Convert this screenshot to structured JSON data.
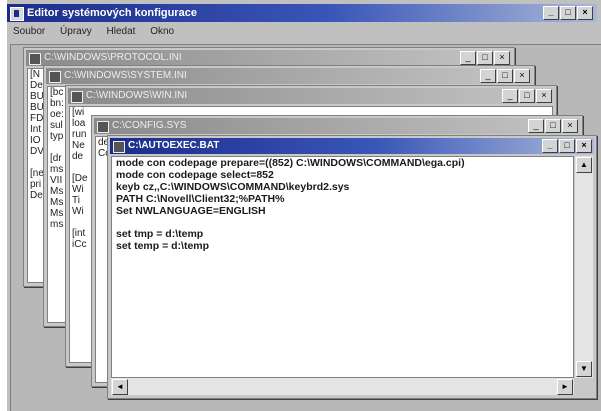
{
  "app": {
    "title": "Editor systémových konfigurace"
  },
  "menu": [
    "Soubor",
    "Úpravy",
    "Hledat",
    "Okno"
  ],
  "caption_buttons": {
    "minimize": "_",
    "maximize": "□",
    "close": "×"
  },
  "windows": [
    {
      "title": "C:\\WINDOWS\\PROTOCOL.INI",
      "lines": [
        "[N",
        "Del",
        "BU",
        "BU",
        "FD",
        "Int",
        "IO",
        "DV",
        "",
        "[ne",
        "pri",
        "Del"
      ]
    },
    {
      "title": "C:\\WINDOWS\\SYSTEM.INI",
      "lines": [
        "[bc",
        "bn:",
        "oe:",
        "sul",
        "typ",
        "",
        "[dr",
        "ms",
        "VII",
        "Ms",
        "Ms",
        "Ms",
        "ms"
      ]
    },
    {
      "title": "C:\\WINDOWS\\WIN.INI",
      "lines": [
        "[wi",
        "loa",
        "run",
        "Ne",
        "de",
        "",
        "[De",
        "Wi",
        "Ti",
        "Wi",
        "",
        "[int",
        "iCc"
      ]
    },
    {
      "title": "C:\\CONFIG.SYS",
      "lines": [
        "de",
        "Co"
      ]
    }
  ],
  "active": {
    "title": "C:\\AUTOEXEC.BAT",
    "lines": [
      "mode con codepage prepare=((852) C:\\WINDOWS\\COMMAND\\ega.cpi)",
      "mode con codepage select=852",
      "keyb cz,,C:\\WINDOWS\\COMMAND\\keybrd2.sys",
      "PATH C:\\Novell\\Client32;%PATH%",
      "Set NWLANGUAGE=ENGLISH",
      "",
      "set tmp = d:\\temp",
      "set temp = d:\\temp"
    ]
  },
  "scroll_arrows": {
    "up": "▲",
    "down": "▼",
    "left": "◄",
    "right": "►"
  }
}
